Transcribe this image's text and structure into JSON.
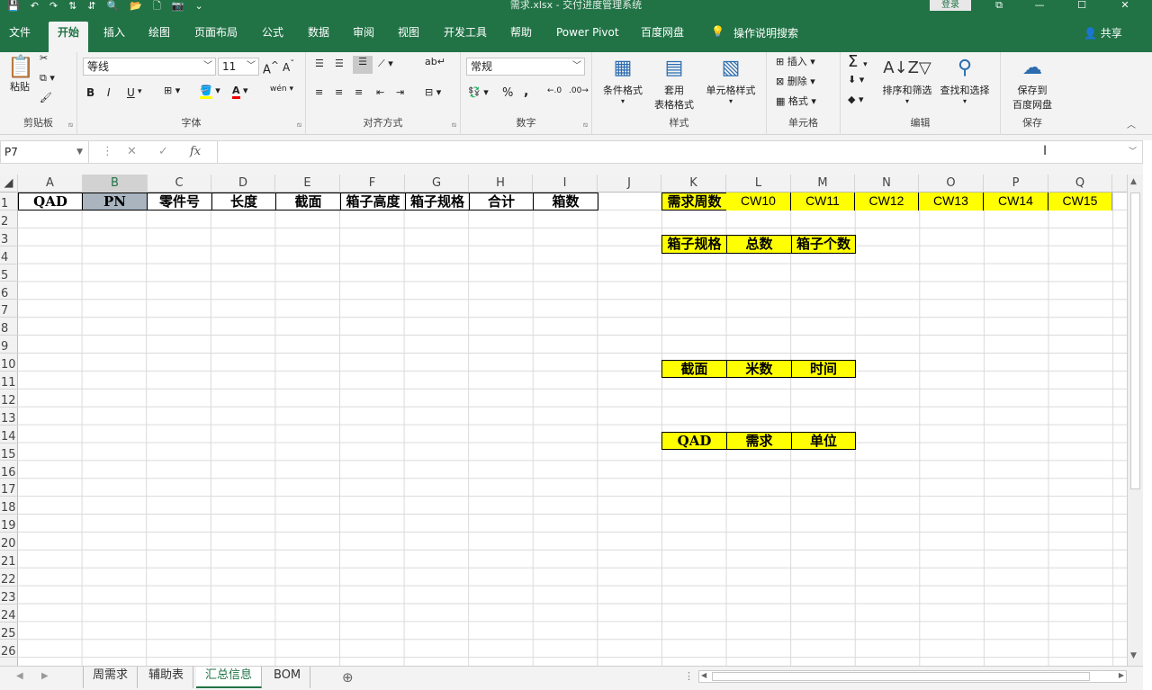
{
  "window": {
    "title": "需求.xlsx - 交付进度管理系统",
    "login_label": "登录",
    "controls": [
      "⧉",
      "—",
      "☐",
      "✕"
    ]
  },
  "qat": [
    "💾",
    "↶",
    "↷",
    "⇅",
    "⇵",
    "🔍",
    "📂",
    "🗋",
    "📷",
    "⌄"
  ],
  "ribbon_tabs": [
    "文件",
    "开始",
    "插入",
    "绘图",
    "页面布局",
    "公式",
    "数据",
    "审阅",
    "视图",
    "开发工具",
    "帮助",
    "Power Pivot",
    "百度网盘"
  ],
  "active_tab": "开始",
  "tell_me": "操作说明搜索",
  "share": "共享",
  "ribbon": {
    "clipboard": {
      "label": "剪贴板",
      "paste": "粘贴"
    },
    "font": {
      "label": "字体",
      "name": "等线",
      "size": "11",
      "bold": "B",
      "italic": "I",
      "underline": "U"
    },
    "align": {
      "label": "对齐方式"
    },
    "number": {
      "label": "数字",
      "format": "常规",
      "percent": "%",
      "comma": ","
    },
    "styles": {
      "label": "样式",
      "cond": "条件格式",
      "table1": "套用",
      "table2": "表格格式",
      "cell": "单元格样式"
    },
    "cells": {
      "label": "单元格",
      "insert": "插入",
      "delete": "删除",
      "format": "格式"
    },
    "editing": {
      "label": "编辑",
      "sort": "排序和筛选",
      "find": "查找和选择"
    },
    "save": {
      "label": "保存",
      "line1": "保存到",
      "line2": "百度网盘"
    }
  },
  "formula_bar": {
    "name_box": "P7",
    "cancel": "✕",
    "enter": "✓",
    "fx": "fx",
    "value": ""
  },
  "columns": [
    "A",
    "B",
    "C",
    "D",
    "E",
    "F",
    "G",
    "H",
    "I",
    "J",
    "K",
    "L",
    "M",
    "N",
    "O",
    "P",
    "Q"
  ],
  "selected_column": "B",
  "rows": [
    "1",
    "2",
    "3",
    "4",
    "5",
    "6",
    "7",
    "8",
    "9",
    "10",
    "11",
    "12",
    "13",
    "14",
    "15",
    "16",
    "17",
    "18",
    "19",
    "20",
    "21",
    "22",
    "23",
    "24",
    "25",
    "26"
  ],
  "cells": {
    "header_row": [
      "QAD",
      "PN",
      "零件号",
      "长度",
      "截面",
      "箱子高度",
      "箱子规格",
      "合计",
      "箱数"
    ],
    "week_label": "需求周数",
    "weeks": [
      "CW10",
      "CW11",
      "CW12",
      "CW13",
      "CW14",
      "CW15"
    ],
    "box_table": [
      "箱子规格",
      "总数",
      "箱子个数"
    ],
    "section_table": [
      "截面",
      "米数",
      "时间"
    ],
    "qad_table": [
      "QAD",
      "需求",
      "单位"
    ]
  },
  "sheets": [
    "周需求",
    "辅助表",
    "汇总信息",
    "BOM"
  ],
  "active_sheet": "汇总信息",
  "colors": {
    "excel_green": "#217346",
    "highlight_yellow": "#ffff00",
    "selected_header": "#a9b4bf"
  }
}
